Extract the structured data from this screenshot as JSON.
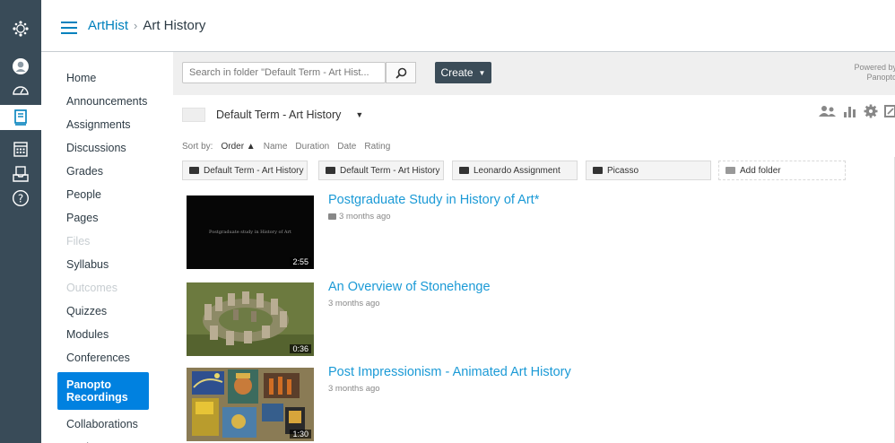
{
  "breadcrumb": {
    "course": "ArtHist",
    "separator": "›",
    "current": "Art History"
  },
  "course_nav": [
    {
      "label": "Home",
      "state": "normal"
    },
    {
      "label": "Announcements",
      "state": "normal"
    },
    {
      "label": "Assignments",
      "state": "normal"
    },
    {
      "label": "Discussions",
      "state": "normal"
    },
    {
      "label": "Grades",
      "state": "normal"
    },
    {
      "label": "People",
      "state": "normal"
    },
    {
      "label": "Pages",
      "state": "normal"
    },
    {
      "label": "Files",
      "state": "disabled"
    },
    {
      "label": "Syllabus",
      "state": "normal"
    },
    {
      "label": "Outcomes",
      "state": "disabled"
    },
    {
      "label": "Quizzes",
      "state": "normal"
    },
    {
      "label": "Modules",
      "state": "normal"
    },
    {
      "label": "Conferences",
      "state": "normal"
    },
    {
      "label": "Panopto Recordings",
      "state": "active"
    },
    {
      "label": "Collaborations",
      "state": "normal"
    },
    {
      "label": "Settings",
      "state": "normal"
    }
  ],
  "panopto": {
    "search_placeholder": "Search in folder \"Default Term - Art Hist...",
    "create_label": "Create",
    "create_caret": "▼",
    "powered_line1": "Powered by",
    "powered_line2": "Panopto",
    "folder_name": "Default Term - Art History",
    "folder_caret": "▼",
    "sort_label": "Sort by:",
    "sort_options": [
      "Order ▲",
      "Name",
      "Duration",
      "Date",
      "Rating"
    ],
    "subfolders": [
      "Default Term - Art History ...",
      "Default Term - Art History ...",
      "Leonardo Assignment",
      "Picasso"
    ],
    "add_folder_label": "Add folder",
    "sessions": [
      {
        "title": "Postgraduate Study in History of Art*",
        "date": "3 months ago",
        "duration": "2:55",
        "thumb_caption": "Postgraduate study in History of Art",
        "has_cc": true
      },
      {
        "title": "An Overview of Stonehenge",
        "date": "3 months ago",
        "duration": "0:36",
        "has_cc": false
      },
      {
        "title": "Post Impressionism - Animated Art History",
        "date": "3 months ago",
        "duration": "1:30",
        "has_cc": false
      }
    ]
  },
  "colors": {
    "global_nav": "#394b58",
    "link": "#0081bd",
    "active_nav": "#0081e0",
    "session_title": "#1b9ad6"
  },
  "icons": [
    "canvas-logo-icon",
    "account-icon",
    "dashboard-icon",
    "courses-icon",
    "calendar-icon",
    "inbox-icon",
    "help-icon",
    "search-icon",
    "viewers-icon",
    "stats-icon",
    "settings-icon",
    "share-icon",
    "folder-icon",
    "captions-icon"
  ]
}
